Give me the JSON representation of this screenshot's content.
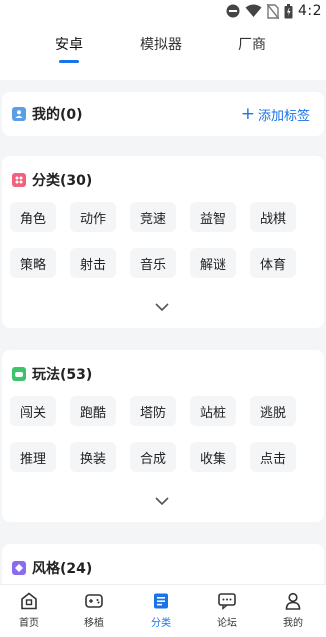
{
  "status_bar": {
    "time": "4:2"
  },
  "top_tabs": [
    {
      "label": "安卓",
      "active": true
    },
    {
      "label": "模拟器",
      "active": false
    },
    {
      "label": "厂商",
      "active": false
    }
  ],
  "my_section": {
    "title": "我的(0)",
    "add_tag_label": "添加标签",
    "icon_color": "#5b9ee8"
  },
  "category_section": {
    "title": "分类(30)",
    "icon_color": "#f0627e",
    "chips": [
      "角色",
      "动作",
      "竞速",
      "益智",
      "战棋",
      "策略",
      "射击",
      "音乐",
      "解谜",
      "体育"
    ]
  },
  "gameplay_section": {
    "title": "玩法(53)",
    "icon_color": "#3cc46a",
    "chips": [
      "闯关",
      "跑酷",
      "塔防",
      "站桩",
      "逃脱",
      "推理",
      "换装",
      "合成",
      "收集",
      "点击"
    ]
  },
  "style_section": {
    "title": "风格(24)",
    "icon_color": "#8a6cf0"
  },
  "bottom_nav": [
    {
      "label": "首页",
      "icon": "home-icon",
      "active": false
    },
    {
      "label": "移植",
      "icon": "gamepad-icon",
      "active": false
    },
    {
      "label": "分类",
      "icon": "category-icon",
      "active": true
    },
    {
      "label": "论坛",
      "icon": "forum-icon",
      "active": false
    },
    {
      "label": "我的",
      "icon": "profile-icon",
      "active": false
    }
  ],
  "colors": {
    "accent": "#1a73e8",
    "background": "#f4f5f7"
  }
}
